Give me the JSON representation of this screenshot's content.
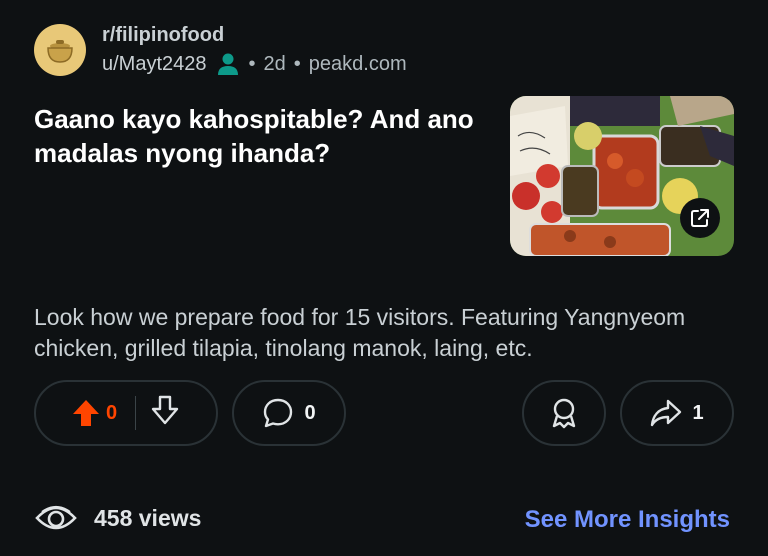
{
  "post": {
    "subreddit": "r/filipinofood",
    "author": "u/Mayt2428",
    "age": "2d",
    "domain": "peakd.com",
    "separator": "•",
    "title": "Gaano kayo kahospitable? And ano madalas nyong ihanda?",
    "body": "Look how we prepare food for 15 visitors. Featuring Yangnyeom chicken, grilled tilapia, tinolang manok, laing, etc."
  },
  "actions": {
    "upvote_count": "0",
    "comment_count": "0",
    "share_count": "1"
  },
  "footer": {
    "views": "458 views",
    "insights_link": "See More Insights"
  },
  "icons": {
    "avatar": "pot-icon",
    "author_badge": "person-icon",
    "upvote": "arrow-up-icon",
    "downvote": "arrow-down-icon",
    "comment": "speech-bubble-icon",
    "award": "award-ribbon-icon",
    "share": "share-arrow-icon",
    "external": "external-link-icon",
    "views": "eye-icon"
  },
  "colors": {
    "background": "#0e1113",
    "upvote_active": "#ff4500",
    "link": "#7193ff",
    "author_badge": "#0d9a8a"
  }
}
